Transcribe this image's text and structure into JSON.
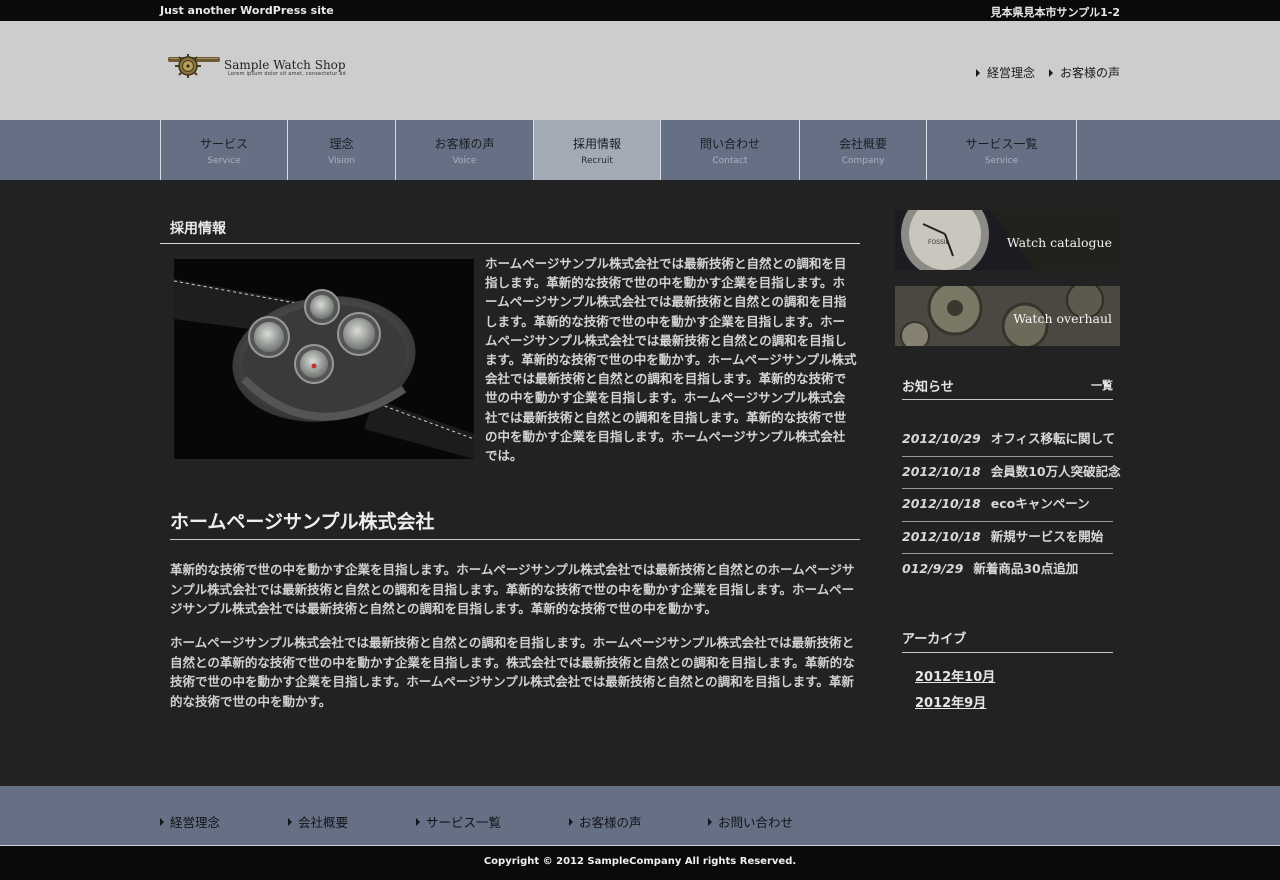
{
  "topbar": {
    "tagline": "Just another WordPress site",
    "address": "見本県見本市サンプル1-2"
  },
  "header": {
    "logo_name": "Sample Watch Shop",
    "logo_sub": "Lorem ipsum dolor sit amet, consectetur ad",
    "links": [
      "経営理念",
      "お客様の声"
    ]
  },
  "nav": {
    "items": [
      {
        "jp": "サービス",
        "en": "Service"
      },
      {
        "jp": "理念",
        "en": "Vision"
      },
      {
        "jp": "お客様の声",
        "en": "Voice"
      },
      {
        "jp": "採用情報",
        "en": "Recruit"
      },
      {
        "jp": "問い合わせ",
        "en": "Contact"
      },
      {
        "jp": "会社概要",
        "en": "Company"
      },
      {
        "jp": "サービス一覧",
        "en": "Service"
      }
    ],
    "active_index": 3
  },
  "main": {
    "page_title": "採用情報",
    "intro": "ホームページサンプル株式会社では最新技術と自然との調和を目指します。革新的な技術で世の中を動かす企業を目指します。ホームページサンプル株式会社では最新技術と自然との調和を目指します。革新的な技術で世の中を動かす企業を目指します。ホームページサンプル株式会社では最新技術と自然との調和を目指します。革新的な技術で世の中を動かす。ホームページサンプル株式会社では最新技術と自然との調和を目指します。革新的な技術で世の中を動かす企業を目指します。ホームページサンプル株式会社では最新技術と自然との調和を目指します。革新的な技術で世の中を動かす企業を目指します。ホームページサンプル株式会社では。",
    "company_heading": "ホームページサンプル株式会社",
    "para1": "革新的な技術で世の中を動かす企業を目指します。ホームページサンプル株式会社では最新技術と自然とのホームページサンプル株式会社では最新技術と自然との調和を目指します。革新的な技術で世の中を動かす企業を目指します。ホームページサンプル株式会社では最新技術と自然との調和を目指します。革新的な技術で世の中を動かす。",
    "para2": "ホームページサンプル株式会社では最新技術と自然との調和を目指します。ホームページサンプル株式会社では最新技術と自然との革新的な技術で世の中を動かす企業を目指します。株式会社では最新技術と自然との調和を目指します。革新的な技術で世の中を動かす企業を目指します。ホームページサンプル株式会社では最新技術と自然との調和を目指します。革新的な技術で世の中を動かす。"
  },
  "sidebar": {
    "banners": [
      "Watch catalogue",
      "Watch overhaul"
    ],
    "news_heading": "お知らせ",
    "news_more": "一覧",
    "news": [
      {
        "date": "2012/10/29",
        "title": "オフィス移転に関して"
      },
      {
        "date": "2012/10/18",
        "title": "会員数10万人突破記念"
      },
      {
        "date": "2012/10/18",
        "title": "ecoキャンペーン"
      },
      {
        "date": "2012/10/18",
        "title": "新規サービスを開始"
      },
      {
        "date": "012/9/29",
        "title": "新着商品30点追加"
      }
    ],
    "archive_heading": "アーカイブ",
    "archive": [
      "2012年10月",
      "2012年9月"
    ]
  },
  "footer": {
    "links": [
      "経営理念",
      "会社概要",
      "サービス一覧",
      "お客様の声",
      "お問い合わせ"
    ],
    "copyright": "Copyright © 2012 SampleCompany All rights Reserved."
  },
  "colors": {
    "nav": "#667085",
    "nav_active": "#a1aab5",
    "header": "#cdcdcd",
    "content": "#222222",
    "topbar": "#0a0a0a"
  }
}
